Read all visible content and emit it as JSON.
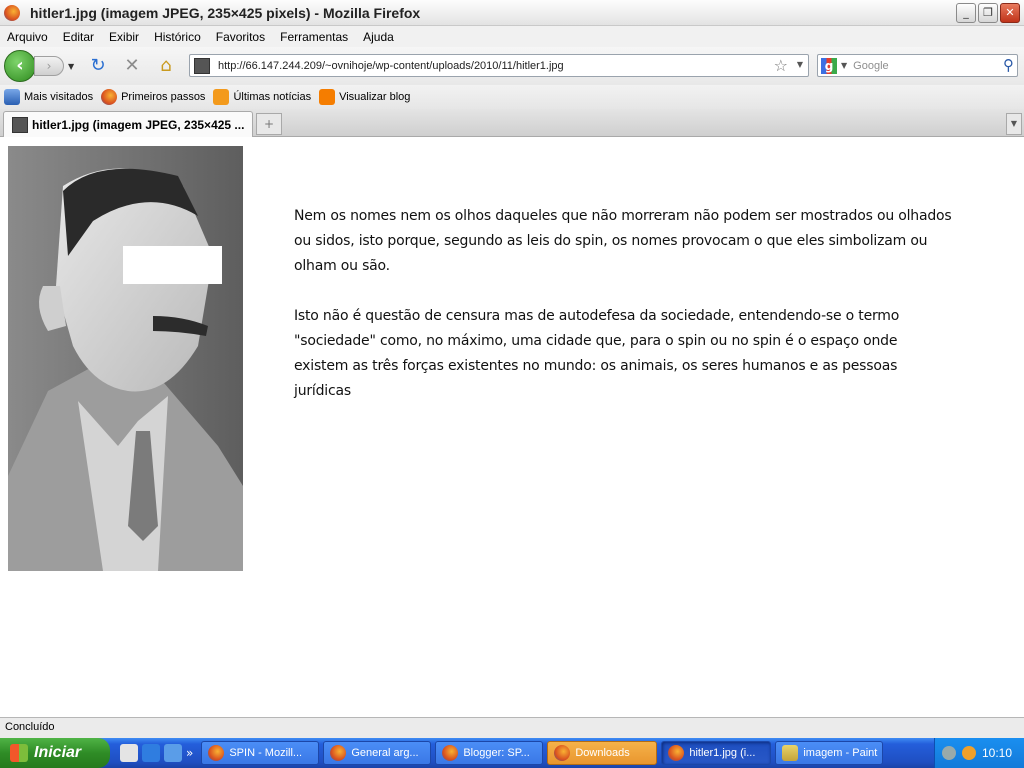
{
  "window": {
    "title": "hitler1.jpg (imagem JPEG, 235×425 pixels) - Mozilla Firefox"
  },
  "menu": [
    "Arquivo",
    "Editar",
    "Exibir",
    "Histórico",
    "Favoritos",
    "Ferramentas",
    "Ajuda"
  ],
  "nav": {
    "url": "http://66.147.244.209/~ovnihoje/wp-content/uploads/2010/11/hitler1.jpg",
    "search_placeholder": "Google"
  },
  "bookmarks": [
    "Mais visitados",
    "Primeiros passos",
    "Últimas notícias",
    "Visualizar blog"
  ],
  "tab": {
    "label": "hitler1.jpg (imagem JPEG, 235×425 ..."
  },
  "content": {
    "paragraph1": "Nem os nomes nem os olhos daqueles que não morreram não podem ser mostrados ou olhados ou sidos, isto porque, segundo as leis do spin, os nomes provocam o que eles simbolizam ou olham ou são.",
    "paragraph2": "Isto não é questão de censura mas de autodefesa da sociedade, entendendo-se o termo \"sociedade\" como, no máximo, uma cidade que,  para o spin ou no spin é o espaço onde existem as três forças existentes no mundo: os animais, os seres humanos e as pessoas jurídicas"
  },
  "status": "Concluído",
  "taskbar": {
    "start": "Iniciar",
    "tasks": [
      "SPIN - Mozill...",
      "General arg...",
      "Blogger: SP...",
      "Downloads",
      "hitler1.jpg (i...",
      "imagem - Paint"
    ],
    "clock": "10:10"
  }
}
